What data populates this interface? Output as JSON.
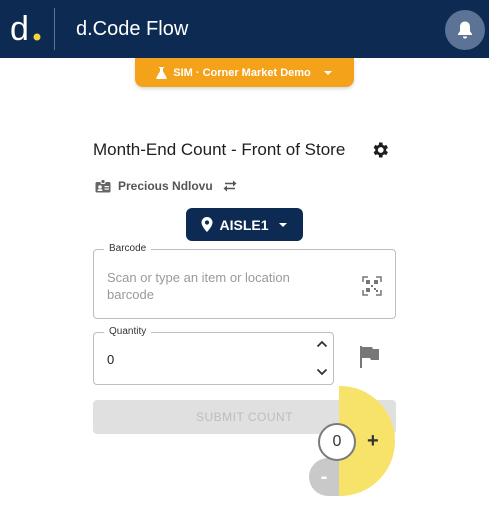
{
  "header": {
    "logo_letter": "d",
    "app_title": "d.Code Flow",
    "colors": {
      "bar": "#0c2a52",
      "logo_dot": "#f2d43c"
    },
    "icons": {
      "notifications": "bell-icon"
    }
  },
  "environment": {
    "label": "SIM · Corner Market Demo",
    "color": "#f5a21b",
    "icons": {
      "lead": "flask-icon",
      "trail": "caret-down-icon"
    }
  },
  "count": {
    "title": "Month-End Count - Front of Store",
    "icons": {
      "settings": "gear-icon"
    }
  },
  "user": {
    "name": "Precious Ndlovu",
    "icons": {
      "badge": "id-badge-icon",
      "switch": "swap-arrows-icon"
    }
  },
  "location": {
    "label": "AISLE1",
    "icons": {
      "pin": "map-pin-icon",
      "dropdown": "caret-down-icon"
    }
  },
  "barcode": {
    "label": "Barcode",
    "placeholder": "Scan or type an item or location barcode",
    "icons": {
      "scan": "qr-scan-icon"
    }
  },
  "quantity": {
    "label": "Quantity",
    "value": "0",
    "icons": {
      "increase": "chevron-up-icon",
      "decrease": "chevron-down-icon",
      "flag": "flag-icon"
    }
  },
  "submit": {
    "label": "SUBMIT COUNT"
  },
  "stepper": {
    "value": "0",
    "plus": "+",
    "minus": "-",
    "color": "#f7e36a"
  }
}
